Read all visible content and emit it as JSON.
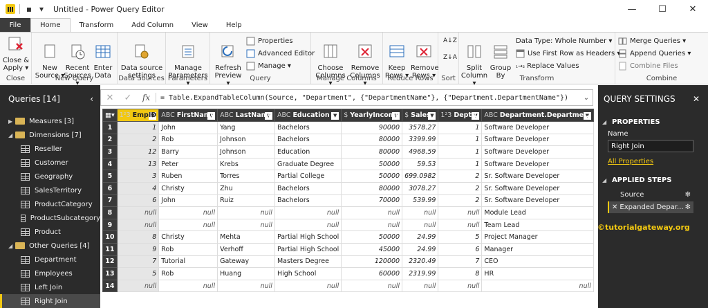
{
  "window": {
    "title": "Untitled - Power Query Editor",
    "controls": [
      "—",
      "☐",
      "✕"
    ]
  },
  "tabs": [
    "File",
    "Home",
    "Transform",
    "Add Column",
    "View",
    "Help"
  ],
  "ribbon": {
    "groups": [
      {
        "label": "Close",
        "buttons": [
          "Close &",
          "Apply ▾"
        ]
      },
      {
        "label": "New Query",
        "buttons": [
          "New\nSource ▾",
          "Recent\nSources ▾",
          "Enter\nData"
        ]
      },
      {
        "label": "Data Sources",
        "buttons": [
          "Data source\nsettings"
        ]
      },
      {
        "label": "Parameters",
        "buttons": [
          "Manage\nParameters ▾"
        ]
      },
      {
        "label": "Query",
        "big": "Refresh\nPreview ▾",
        "small": [
          "Properties",
          "Advanced Editor",
          "Manage ▾"
        ]
      },
      {
        "label": "Manage Columns",
        "buttons": [
          "Choose\nColumns ▾",
          "Remove\nColumns ▾"
        ]
      },
      {
        "label": "Reduce Rows",
        "buttons": [
          "Keep\nRows ▾",
          "Remove\nRows ▾"
        ]
      },
      {
        "label": "Sort",
        "buttons": []
      },
      {
        "label": "Transform",
        "big": [
          "Split\nColumn ▾",
          "Group\nBy"
        ],
        "small": [
          "Data Type: Whole Number ▾",
          "Use First Row as Headers ▾",
          "Replace Values"
        ]
      },
      {
        "label": "Combine",
        "small": [
          "Merge Queries ▾",
          "Append Queries ▾",
          "Combine Files"
        ]
      }
    ]
  },
  "queries": {
    "header": "Queries [14]",
    "items": [
      {
        "type": "folder",
        "label": "Measures [3]",
        "expanded": false
      },
      {
        "type": "folder",
        "label": "Dimensions [7]",
        "expanded": true
      },
      {
        "type": "table",
        "label": "Reseller"
      },
      {
        "type": "table",
        "label": "Customer"
      },
      {
        "type": "table",
        "label": "Geography"
      },
      {
        "type": "table",
        "label": "SalesTerritory"
      },
      {
        "type": "table",
        "label": "ProductCategory"
      },
      {
        "type": "table",
        "label": "ProductSubcategory"
      },
      {
        "type": "table",
        "label": "Product"
      },
      {
        "type": "folder",
        "label": "Other Queries [4]",
        "expanded": true
      },
      {
        "type": "table",
        "label": "Department"
      },
      {
        "type": "table",
        "label": "Employees"
      },
      {
        "type": "table",
        "label": "Left Join"
      },
      {
        "type": "table",
        "label": "Right Join",
        "selected": true
      }
    ]
  },
  "formula": {
    "text": "= Table.ExpandTableColumn(Source, \"Department\", {\"DepartmentName\"}, {\"Department.DepartmentName\"})",
    "fx": "fx"
  },
  "table": {
    "columns": [
      {
        "type": "1²3",
        "name": "EmpID"
      },
      {
        "type": "ABC",
        "name": "FirstName"
      },
      {
        "type": "ABC",
        "name": "LastName"
      },
      {
        "type": "ABC",
        "name": "Education"
      },
      {
        "type": "$",
        "name": "YearlyIncome"
      },
      {
        "type": "$",
        "name": "Sales"
      },
      {
        "type": "1²3",
        "name": "DeptID"
      },
      {
        "type": "ABC",
        "name": "Department.Departme..."
      }
    ],
    "rows": [
      [
        "1",
        "John",
        "Yang",
        "Bachelors",
        "90000",
        "3578.27",
        "1",
        "Software Developer"
      ],
      [
        "2",
        "Rob",
        "Johnson",
        "Bachelors",
        "80000",
        "3399.99",
        "1",
        "Software Developer"
      ],
      [
        "12",
        "Barry",
        "Johnson",
        "Education",
        "80000",
        "4968.59",
        "1",
        "Software Developer"
      ],
      [
        "13",
        "Peter",
        "Krebs",
        "Graduate Degree",
        "50000",
        "59.53",
        "1",
        "Software Developer"
      ],
      [
        "3",
        "Ruben",
        "Torres",
        "Partial College",
        "50000",
        "699.0982",
        "2",
        "Sr. Software Developer"
      ],
      [
        "4",
        "Christy",
        "Zhu",
        "Bachelors",
        "80000",
        "3078.27",
        "2",
        "Sr. Software Developer"
      ],
      [
        "6",
        "John",
        "Ruiz",
        "Bachelors",
        "70000",
        "539.99",
        "2",
        "Sr. Software Developer"
      ],
      [
        "null",
        "null",
        "null",
        "null",
        "null",
        "null",
        "null",
        "Module Lead"
      ],
      [
        "null",
        "null",
        "null",
        "null",
        "null",
        "null",
        "null",
        "Team Lead"
      ],
      [
        "8",
        "Christy",
        "Mehta",
        "Partial High School",
        "50000",
        "24.99",
        "5",
        "Project Manager"
      ],
      [
        "9",
        "Rob",
        "Verhoff",
        "Partial High School",
        "45000",
        "24.99",
        "6",
        "Manager"
      ],
      [
        "7",
        "Tutorial",
        "Gateway",
        "Masters Degree",
        "120000",
        "2320.49",
        "7",
        "CEO"
      ],
      [
        "5",
        "Rob",
        "Huang",
        "High School",
        "60000",
        "2319.99",
        "8",
        "HR"
      ],
      [
        "null",
        "null",
        "null",
        "null",
        "null",
        "null",
        "null",
        "null"
      ]
    ]
  },
  "settings": {
    "header": "QUERY SETTINGS",
    "properties_label": "PROPERTIES",
    "name_label": "Name",
    "name_value": "Right Join",
    "all_properties": "All Properties",
    "applied_steps_label": "APPLIED STEPS",
    "steps": [
      "Source",
      "Expanded Depar..."
    ]
  },
  "watermark": "©tutorialgateway.org",
  "colors": {
    "accent": "#f2c811",
    "dark_pane": "#2b2b2b",
    "header": "#3a3a3a"
  }
}
